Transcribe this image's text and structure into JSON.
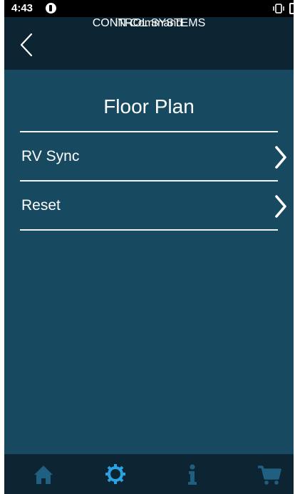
{
  "status_bar": {
    "time": "4:43",
    "icons": [
      "notification-icon",
      "vibrate-icon",
      "battery-icon"
    ]
  },
  "header": {
    "back_icon": "chevron-left-icon",
    "logo_main": "iN·Command",
    "logo_sub": "CONTROL SYSTEMS"
  },
  "page": {
    "title": "Floor Plan",
    "items": [
      {
        "label": "RV Sync",
        "icon": "chevron-right-icon"
      },
      {
        "label": "Reset",
        "icon": "chevron-right-icon"
      }
    ]
  },
  "bottom_nav": {
    "items": [
      {
        "icon": "home-icon",
        "active": false
      },
      {
        "icon": "gear-icon",
        "active": true
      },
      {
        "icon": "info-icon",
        "active": false
      },
      {
        "icon": "cart-icon",
        "active": false
      }
    ]
  },
  "colors": {
    "background": "#174a60",
    "bars": "#0d2433",
    "active_icon": "#2aa3e3",
    "inactive_icon": "#1f5f80"
  }
}
